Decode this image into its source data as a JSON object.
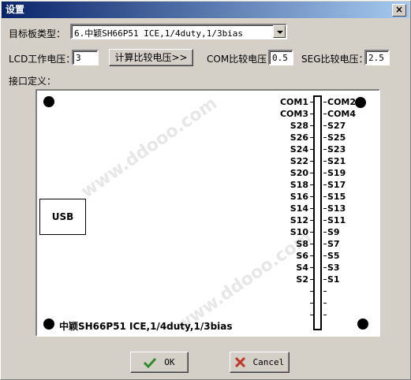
{
  "window": {
    "title": "设置",
    "close_label": "×"
  },
  "board_type": {
    "label": "目标板类型：",
    "value": "6.中颖SH66P51 ICE,1/4duty,1/3bias"
  },
  "lcd_voltage": {
    "label": "LCD工作电压：",
    "value": "3"
  },
  "calc_button": {
    "label": "计算比较电压>>"
  },
  "com_voltage": {
    "label": "COM比较电压：",
    "value": "0.5"
  },
  "seg_voltage": {
    "label": "SEG比较电压：",
    "value": "2.5"
  },
  "interface": {
    "label": "接口定义："
  },
  "diagram": {
    "usb_label": "USB",
    "board_label": "中颖SH66P51 ICE,1/4duty,1/3bias",
    "left_pins": [
      "COM1",
      "COM3",
      "S28",
      "S26",
      "S24",
      "S22",
      "S20",
      "S18",
      "S16",
      "S14",
      "S12",
      "S10",
      "S8",
      "S6",
      "S4",
      "S2"
    ],
    "right_pins": [
      "COM2",
      "COM4",
      "S27",
      "S25",
      "S23",
      "S21",
      "S19",
      "S17",
      "S15",
      "S13",
      "S11",
      "S9",
      "S7",
      "S5",
      "S3",
      "S1"
    ],
    "watermark": "www.ddooo.com"
  },
  "buttons": {
    "ok": "OK",
    "cancel": "Cancel"
  },
  "colors": {
    "titlebar_start": "#0a246a",
    "titlebar_end": "#a6caf0",
    "ok_check": "#2e8b2e",
    "cancel_x": "#c0392b"
  }
}
